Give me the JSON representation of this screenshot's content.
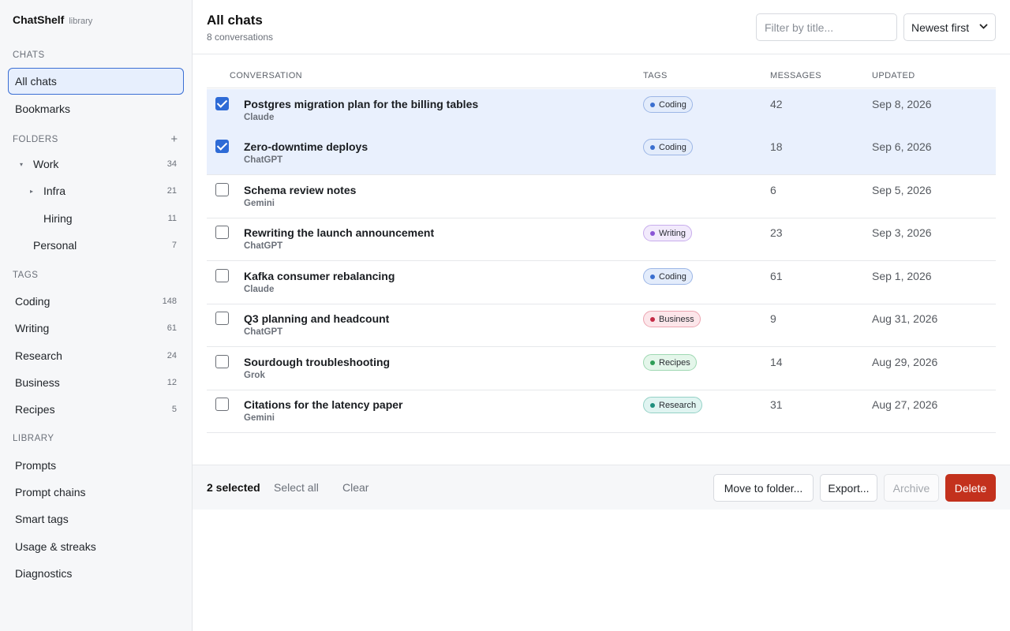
{
  "brand": {
    "name": "ChatShelf",
    "sub": "library"
  },
  "sidebar": {
    "chats_heading": "CHATS",
    "chats": [
      {
        "label": "All chats",
        "active": true
      },
      {
        "label": "Bookmarks",
        "active": false
      }
    ],
    "folders_heading": "FOLDERS",
    "folders_add": "+",
    "folders": [
      {
        "label": "Work",
        "count": "34",
        "caret": "▾"
      },
      {
        "label": "Infra",
        "count": "21",
        "caret": "▸"
      },
      {
        "label": "Hiring",
        "count": "11",
        "caret": ""
      },
      {
        "label": "Personal",
        "count": "7",
        "caret": ""
      }
    ],
    "tags_heading": "TAGS",
    "tags": [
      {
        "label": "Coding",
        "count": "148"
      },
      {
        "label": "Writing",
        "count": "61"
      },
      {
        "label": "Research",
        "count": "24"
      },
      {
        "label": "Business",
        "count": "12"
      },
      {
        "label": "Recipes",
        "count": "5"
      }
    ],
    "library_heading": "LIBRARY",
    "library": [
      {
        "label": "Prompts"
      },
      {
        "label": "Prompt chains"
      },
      {
        "label": "Smart tags"
      },
      {
        "label": "Usage & streaks"
      },
      {
        "label": "Diagnostics"
      }
    ]
  },
  "header": {
    "title": "All chats",
    "subtitle": "8 conversations",
    "filter_placeholder": "Filter by title...",
    "sort_value": "Newest first"
  },
  "table": {
    "columns": {
      "conversation": "CONVERSATION",
      "tags": "TAGS",
      "messages": "MESSAGES",
      "updated": "UPDATED"
    },
    "rows": [
      {
        "title": "Postgres migration plan for the billing tables",
        "model": "Claude",
        "tag": "Coding",
        "messages": "42",
        "updated": "Sep 8, 2026",
        "selected": true
      },
      {
        "title": "Zero-downtime deploys",
        "model": "ChatGPT",
        "tag": "Coding",
        "messages": "18",
        "updated": "Sep 6, 2026",
        "selected": true
      },
      {
        "title": "Schema review notes",
        "model": "Gemini",
        "tag": "",
        "messages": "6",
        "updated": "Sep 5, 2026",
        "selected": false
      },
      {
        "title": "Rewriting the launch announcement",
        "model": "ChatGPT",
        "tag": "Writing",
        "messages": "23",
        "updated": "Sep 3, 2026",
        "selected": false
      },
      {
        "title": "Kafka consumer rebalancing",
        "model": "Claude",
        "tag": "Coding",
        "messages": "61",
        "updated": "Sep 1, 2026",
        "selected": false
      },
      {
        "title": "Q3 planning and headcount",
        "model": "ChatGPT",
        "tag": "Business",
        "messages": "9",
        "updated": "Aug 31, 2026",
        "selected": false
      },
      {
        "title": "Sourdough troubleshooting",
        "model": "Grok",
        "tag": "Recipes",
        "messages": "14",
        "updated": "Aug 29, 2026",
        "selected": false
      },
      {
        "title": "Citations for the latency paper",
        "model": "Gemini",
        "tag": "Research",
        "messages": "31",
        "updated": "Aug 27, 2026",
        "selected": false
      }
    ]
  },
  "tag_colors": {
    "Coding": {
      "bg": "#e3ecfb",
      "border": "#9cb6e6",
      "dot": "#3a6fd0"
    },
    "Writing": {
      "bg": "#f2eafc",
      "border": "#c8adec",
      "dot": "#8a55d6"
    },
    "Business": {
      "bg": "#fce6ea",
      "border": "#eca5b1",
      "dot": "#c42a45"
    },
    "Recipes": {
      "bg": "#e4f6ea",
      "border": "#9fd8b2",
      "dot": "#2f9d57"
    },
    "Research": {
      "bg": "#e0f4f1",
      "border": "#94d1c6",
      "dot": "#1f8f7d"
    }
  },
  "actionbar": {
    "selected_count": "2 selected",
    "select_all": "Select all",
    "clear": "Clear",
    "move": "Move to folder...",
    "export": "Export...",
    "archive": "Archive",
    "delete": "Delete"
  },
  "accent": "#2e6bd6",
  "danger": "#c3311d"
}
